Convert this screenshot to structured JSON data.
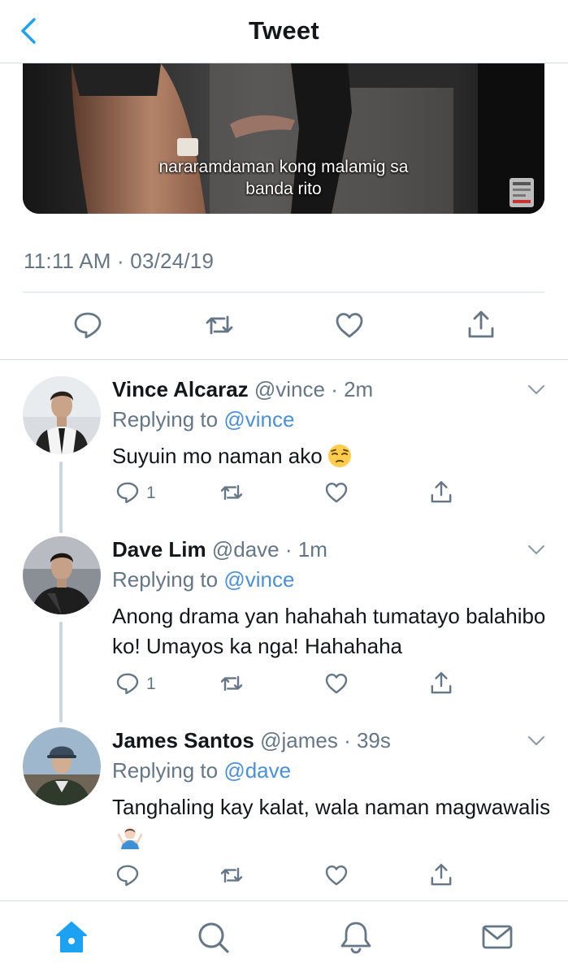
{
  "header": {
    "title": "Tweet",
    "back_icon": "chevron-left-icon"
  },
  "media": {
    "subtitle_lines": [
      "nararamdaman kong malamig sa",
      "banda rito"
    ]
  },
  "tweet": {
    "timestamp": "11:11 AM · 03/24/19"
  },
  "actions": [
    "reply-icon",
    "retweet-icon",
    "like-icon",
    "share-icon"
  ],
  "replies": [
    {
      "name": "Vince Alcaraz",
      "handle": "@vince",
      "time": "2m",
      "replying_prefix": "Replying to",
      "replying_to": "@vince",
      "text": "Suyuin mo naman ako",
      "emoji": "pensive-face-emoji",
      "reply_count": "1"
    },
    {
      "name": "Dave Lim",
      "handle": "@dave",
      "time": "1m",
      "replying_prefix": "Replying to",
      "replying_to": "@vince",
      "text": "Anong drama yan hahahah tumatayo balahibo ko! Umayos ka nga! Hahahaha",
      "reply_count": "1"
    },
    {
      "name": "James Santos",
      "handle": "@james",
      "time": "39s",
      "replying_prefix": "Replying to",
      "replying_to": "@dave",
      "text": "Tanghaling kay kalat, wala naman magwawalis",
      "emoji": "person-shrugging-emoji",
      "reply_count": ""
    }
  ],
  "tabbar": [
    "home-icon",
    "search-icon",
    "notifications-icon",
    "messages-icon"
  ],
  "colors": {
    "accent": "#1da1f2",
    "muted": "#657786",
    "mention": "#4a90d9",
    "divider": "#d8dde2"
  }
}
